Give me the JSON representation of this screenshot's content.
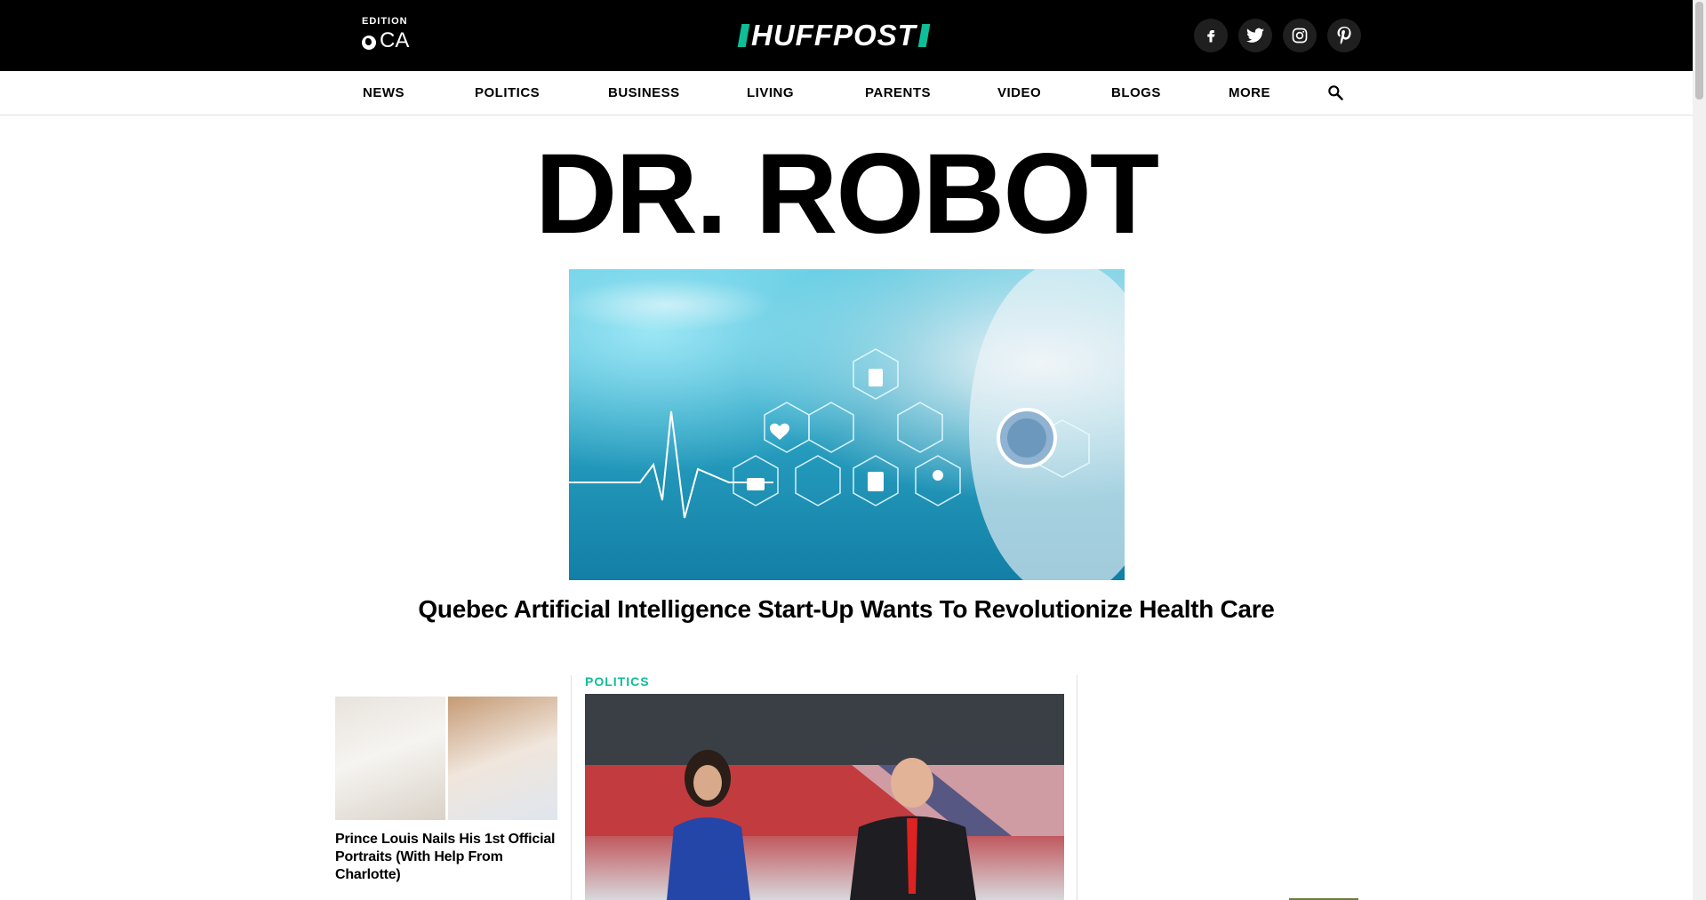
{
  "header": {
    "edition_label": "EDITION",
    "edition_value": "CA",
    "logo_text": "HUFFPOST",
    "brand_color": "#0dbe98",
    "socials": [
      {
        "name": "facebook-icon",
        "glyph": "f"
      },
      {
        "name": "twitter-icon",
        "glyph": "t"
      },
      {
        "name": "instagram-icon",
        "glyph": "◎"
      },
      {
        "name": "pinterest-icon",
        "glyph": "P"
      }
    ]
  },
  "nav": {
    "items": [
      "NEWS",
      "POLITICS",
      "BUSINESS",
      "LIVING",
      "PARENTS",
      "VIDEO",
      "BLOGS",
      "MORE"
    ],
    "search_icon": "search-icon"
  },
  "hero": {
    "headline": "DR. ROBOT",
    "caption": "Quebec Artificial Intelligence Start-Up Wants To Revolutionize Health Care"
  },
  "cards": {
    "left": {
      "title": "Prince Louis Nails His 1st Official Portraits (With Help From Charlotte)"
    },
    "center": {
      "section": "POLITICS"
    }
  }
}
